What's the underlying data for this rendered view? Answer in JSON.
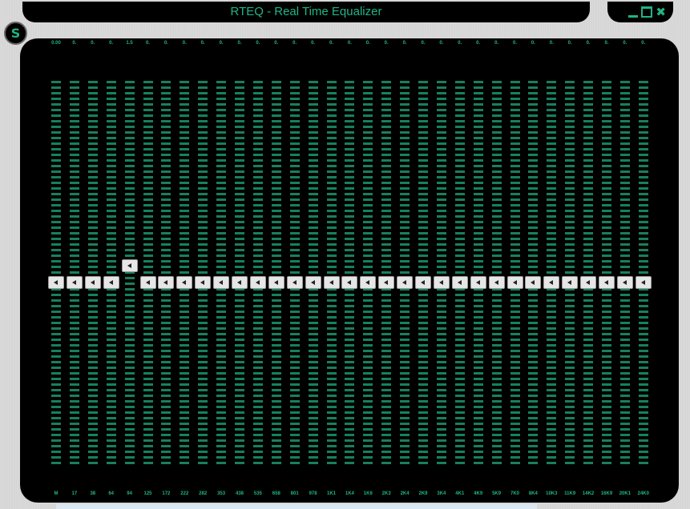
{
  "window": {
    "title": "RTEQ - Real Time Equalizer",
    "logo_letter": "S"
  },
  "controls": [
    {
      "name": "minimize-button",
      "glyph": ""
    },
    {
      "name": "maximize-button",
      "glyph": ""
    },
    {
      "name": "close-button",
      "glyph": "✖"
    }
  ],
  "colors": {
    "accent": "#20b486",
    "led": "#17805e",
    "panel": "#000000"
  },
  "bands": [
    {
      "label": "M",
      "top_value": "0.00",
      "level": 0
    },
    {
      "label": "17",
      "top_value": "0.",
      "level": 0
    },
    {
      "label": "38",
      "top_value": "0.",
      "level": 0
    },
    {
      "label": "64",
      "top_value": "0.",
      "level": 0
    },
    {
      "label": "94",
      "top_value": "1.5",
      "level": 1.5
    },
    {
      "label": "125",
      "top_value": "0.",
      "level": 0
    },
    {
      "label": "172",
      "top_value": "0.",
      "level": 0
    },
    {
      "label": "222",
      "top_value": "0.",
      "level": 0
    },
    {
      "label": "282",
      "top_value": "0.",
      "level": 0
    },
    {
      "label": "353",
      "top_value": "0.",
      "level": 0
    },
    {
      "label": "438",
      "top_value": "0.",
      "level": 0
    },
    {
      "label": "535",
      "top_value": "0.",
      "level": 0
    },
    {
      "label": "658",
      "top_value": "0.",
      "level": 0
    },
    {
      "label": "801",
      "top_value": "0.",
      "level": 0
    },
    {
      "label": "978",
      "top_value": "0.",
      "level": 0
    },
    {
      "label": "1K1",
      "top_value": "0.",
      "level": 0
    },
    {
      "label": "1K4",
      "top_value": "0.",
      "level": 0
    },
    {
      "label": "1K6",
      "top_value": "0.",
      "level": 0
    },
    {
      "label": "2K3",
      "top_value": "0.",
      "level": 0
    },
    {
      "label": "2K4",
      "top_value": "0.",
      "level": 0
    },
    {
      "label": "2K9",
      "top_value": "0.",
      "level": 0
    },
    {
      "label": "3K4",
      "top_value": "0.",
      "level": 0
    },
    {
      "label": "4K1",
      "top_value": "0.",
      "level": 0
    },
    {
      "label": "4K9",
      "top_value": "0.",
      "level": 0
    },
    {
      "label": "5K9",
      "top_value": "0.",
      "level": 0
    },
    {
      "label": "7K0",
      "top_value": "0.",
      "level": 0
    },
    {
      "label": "8K4",
      "top_value": "0.",
      "level": 0
    },
    {
      "label": "10K3",
      "top_value": "0.",
      "level": 0
    },
    {
      "label": "11K9",
      "top_value": "0.",
      "level": 0
    },
    {
      "label": "14K2",
      "top_value": "0.",
      "level": 0
    },
    {
      "label": "16K9",
      "top_value": "0.",
      "level": 0
    },
    {
      "label": "20K1",
      "top_value": "0.",
      "level": 0
    },
    {
      "label": "24K0",
      "top_value": "0.",
      "level": 0
    }
  ]
}
